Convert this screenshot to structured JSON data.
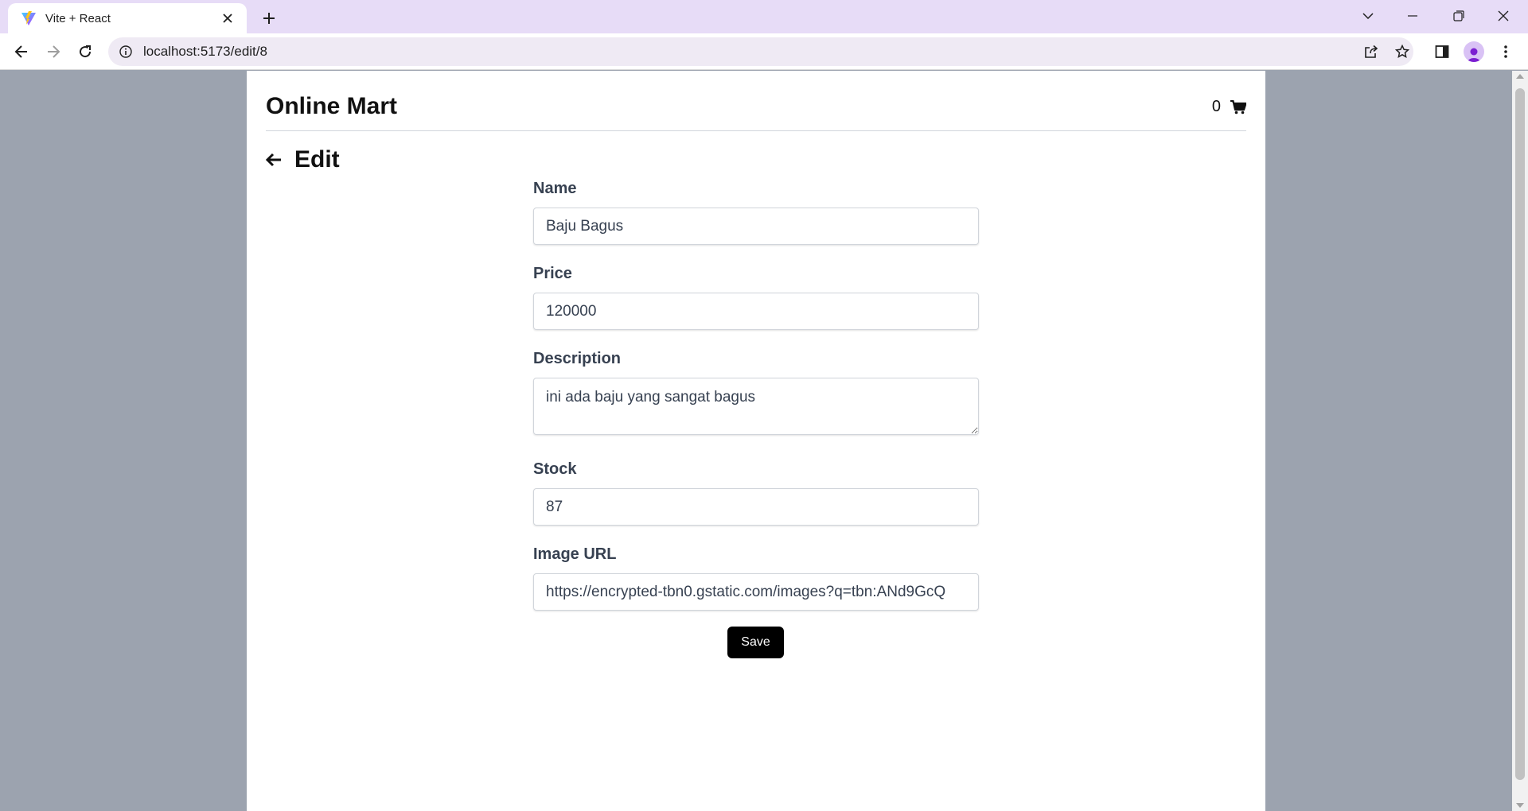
{
  "browser": {
    "tab_title": "Vite + React",
    "url": "localhost:5173/edit/8"
  },
  "app": {
    "brand": "Online Mart",
    "cart_count": "0"
  },
  "page": {
    "title": "Edit"
  },
  "form": {
    "name_label": "Name",
    "name_value": "Baju Bagus",
    "price_label": "Price",
    "price_value": "120000",
    "description_label": "Description",
    "description_value": "ini ada baju yang sangat bagus",
    "stock_label": "Stock",
    "stock_value": "87",
    "image_url_label": "Image URL",
    "image_url_value": "https://encrypted-tbn0.gstatic.com/images?q=tbn:ANd9GcQ",
    "save_label": "Save"
  }
}
